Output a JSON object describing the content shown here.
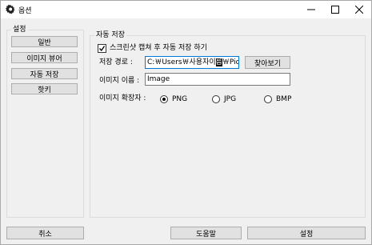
{
  "window": {
    "title": "옵션"
  },
  "sidebar": {
    "group_label": "설정",
    "items": [
      {
        "label": "일반"
      },
      {
        "label": "이미지 뷰어"
      },
      {
        "label": "자동 저장"
      },
      {
        "label": "핫키"
      }
    ]
  },
  "autosave": {
    "group_label": "자동 저장",
    "capture_checkbox_label": "스크린샷 캡쳐 후 자동 저장 하기",
    "capture_checked": true,
    "path_label": "저장 경로 :",
    "path_value_pre": "C:￦Users￦사용자이",
    "path_value_selected": "름",
    "path_value_post": "￦Pictures￦",
    "browse_label": "찾아보기",
    "name_label": "이미지 이름 :",
    "name_value": "Image",
    "ext_label": "이미지 확장자 :",
    "ext_options": [
      {
        "label": "PNG",
        "selected": true
      },
      {
        "label": "JPG",
        "selected": false
      },
      {
        "label": "BMP",
        "selected": false
      }
    ]
  },
  "footer": {
    "cancel_label": "취소",
    "help_label": "도움말",
    "apply_label": "설정"
  }
}
